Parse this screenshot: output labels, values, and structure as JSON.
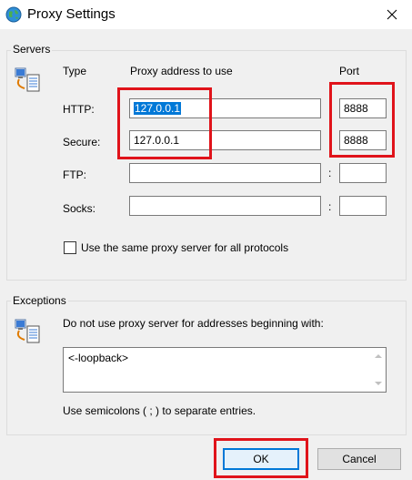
{
  "window": {
    "title": "Proxy Settings"
  },
  "servers": {
    "group_title": "Servers",
    "col_type": "Type",
    "col_address": "Proxy address to use",
    "col_port": "Port",
    "colon": ":",
    "rows": [
      {
        "type": "HTTP:",
        "address": "127.0.0.1",
        "port": "8888"
      },
      {
        "type": "Secure:",
        "address": "127.0.0.1",
        "port": "8888"
      },
      {
        "type": "FTP:",
        "address": "",
        "port": ""
      },
      {
        "type": "Socks:",
        "address": "",
        "port": ""
      }
    ],
    "same_proxy_label": "Use the same proxy server for all protocols",
    "same_proxy_checked": false
  },
  "exceptions": {
    "group_title": "Exceptions",
    "description": "Do not use proxy server for addresses beginning with:",
    "value": "<-loopback>",
    "hint": "Use semicolons ( ; ) to separate entries."
  },
  "buttons": {
    "ok": "OK",
    "cancel": "Cancel"
  },
  "colors": {
    "highlight": "#e0131a",
    "selection": "#0078d7",
    "dialog_bg": "#f0f0f0"
  },
  "icons": {
    "title": "globe-icon",
    "servers": "network-computer-icon",
    "exceptions": "network-computer-icon",
    "close": "close-icon"
  }
}
